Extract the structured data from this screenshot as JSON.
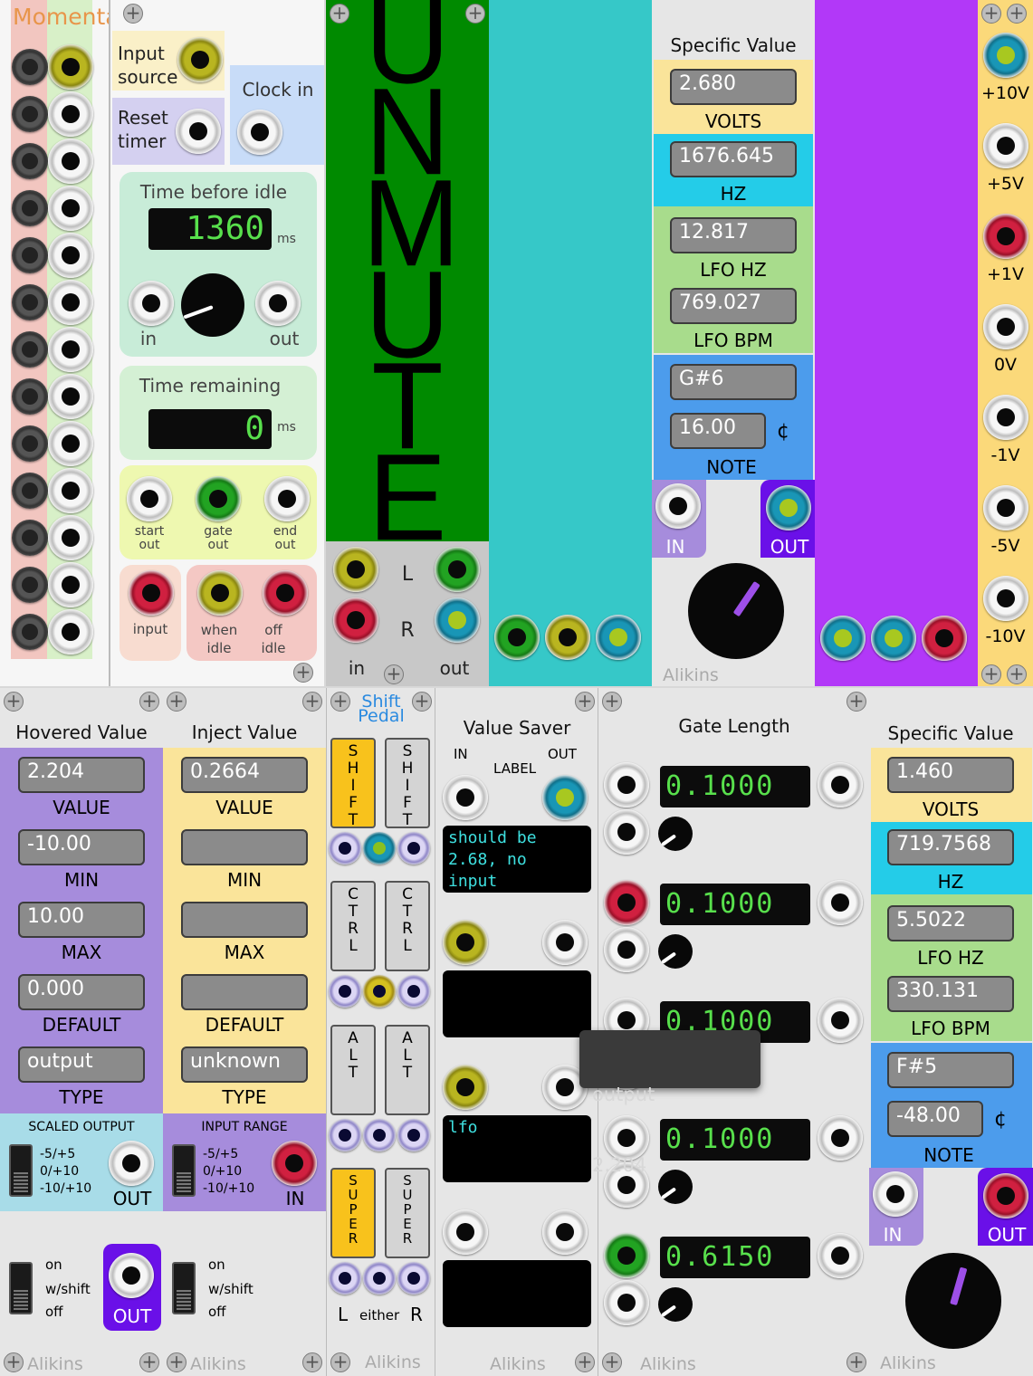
{
  "momentary": {
    "title": "Momentary"
  },
  "idle_timer": {
    "input_source": "Input source",
    "reset_timer": "Reset timer",
    "clock_in": "Clock in",
    "time_before_idle": "Time before idle",
    "time_before_idle_value": "1360",
    "ms": "ms",
    "in": "in",
    "out": "out",
    "time_remaining": "Time remaining",
    "time_remaining_value": "0",
    "start_out": "start out",
    "gate_out": "gate out",
    "end_out": "end out",
    "input": "input",
    "when_idle": "when idle",
    "off_idle": "off idle"
  },
  "unmute": {
    "title": "UNMUTE",
    "l": "L",
    "r": "R",
    "in": "in",
    "out": "out"
  },
  "specific_value_top": {
    "title": "Specific Value",
    "volts": "2.680",
    "volts_label": "VOLTS",
    "hz": "1676.645",
    "hz_label": "HZ",
    "lfo_hz": "12.817",
    "lfo_hz_label": "LFO HZ",
    "lfo_bpm": "769.027",
    "lfo_bpm_label": "LFO BPM",
    "note": "G#6",
    "cents": "16.00",
    "cent_symbol": "¢",
    "note_label": "NOTE",
    "in": "IN",
    "out": "OUT",
    "brand": "Alikins"
  },
  "reference_voltages": {
    "labels": [
      "+10V",
      "+5V",
      "+1V",
      "0V",
      "-1V",
      "-5V",
      "-10V"
    ]
  },
  "hovered_value": {
    "title": "Hovered Value",
    "value": "2.204",
    "value_label": "VALUE",
    "min": "-10.00",
    "min_label": "MIN",
    "max": "10.00",
    "max_label": "MAX",
    "default": "0.000",
    "default_label": "DEFAULT",
    "type": "output",
    "type_label": "TYPE",
    "scaled_output": "SCALED OUTPUT",
    "ranges": [
      "-5/+5",
      "0/+10",
      "-10/+10"
    ],
    "out": "OUT",
    "switch_labels": [
      "on",
      "w/shift",
      "off"
    ],
    "out2": "OUT",
    "brand": "Alikins"
  },
  "inject_value": {
    "title": "Inject Value",
    "value": "0.2664",
    "value_label": "VALUE",
    "min": "",
    "min_label": "MIN",
    "max": "",
    "max_label": "MAX",
    "default": "",
    "default_label": "DEFAULT",
    "type": "unknown",
    "type_label": "TYPE",
    "input_range": "INPUT RANGE",
    "ranges": [
      "-5/+5",
      "0/+10",
      "-10/+10"
    ],
    "in": "IN",
    "switch_labels": [
      "on",
      "w/shift",
      "off"
    ],
    "brand": "Alikins"
  },
  "shift_pedal": {
    "title_line1": "Shift",
    "title_line2": "Pedal",
    "shift": "SHIFT",
    "ctrl": "CTRL",
    "alt": "ALT",
    "super": "SUPER",
    "l": "L",
    "either": "either",
    "r": "R",
    "brand": "Alikins"
  },
  "value_saver": {
    "title": "Value Saver",
    "in": "IN",
    "label": "LABEL",
    "out": "OUT",
    "labels": [
      "should be\n2.68, no\ninput",
      "",
      "lfo",
      ""
    ],
    "brand": "Alikins"
  },
  "gate_length": {
    "title": "Gate Length",
    "values": [
      "0.1000",
      "0.1000",
      "0.1000",
      "0.1000",
      "0.6150"
    ],
    "brand": "Alikins"
  },
  "tooltip": {
    "line1": "output",
    "line2": "2.204"
  },
  "specific_value_bottom": {
    "title": "Specific Value",
    "volts": "1.460",
    "volts_label": "VOLTS",
    "hz": "719.7568",
    "hz_label": "HZ",
    "lfo_hz": "5.5022",
    "lfo_hz_label": "LFO HZ",
    "lfo_bpm": "330.131",
    "lfo_bpm_label": "LFO BPM",
    "note": "F#5",
    "cents": "-48.00",
    "cent_symbol": "¢",
    "note_label": "NOTE",
    "in": "IN",
    "out": "OUT",
    "brand": "Alikins"
  }
}
